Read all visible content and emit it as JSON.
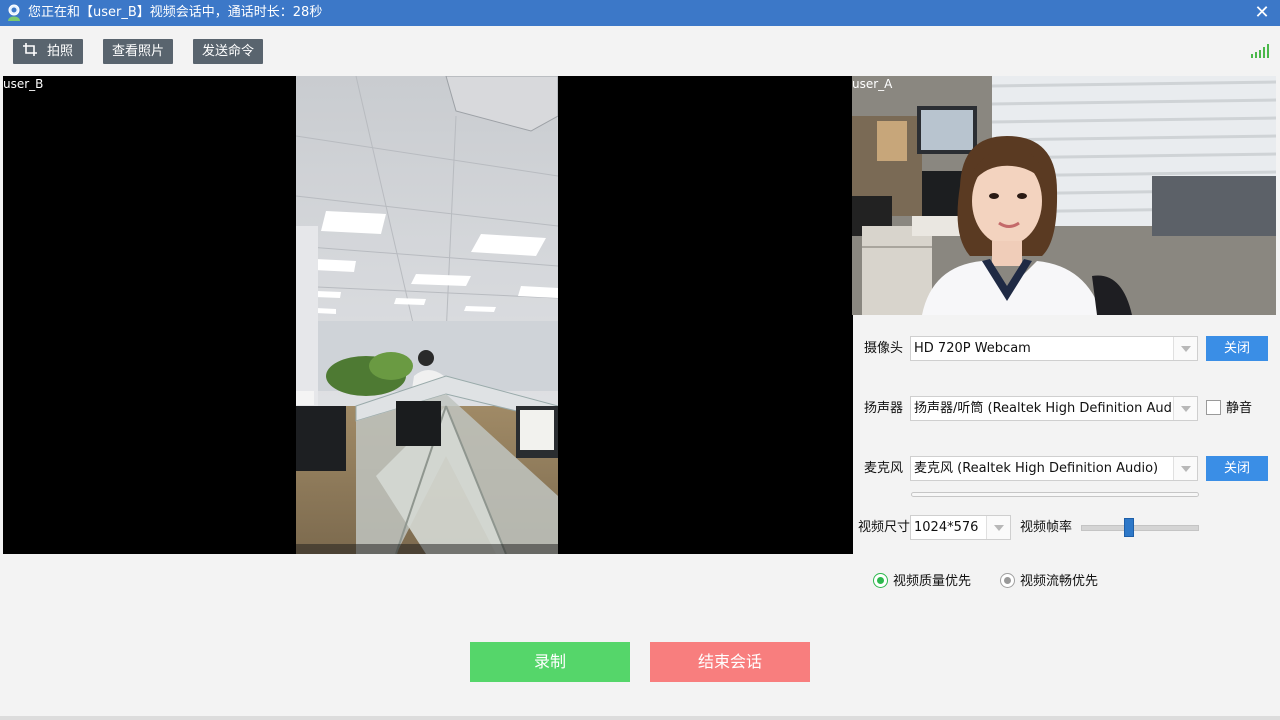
{
  "window": {
    "title": "您正在和【user_B】视频会话中，通话时长：28秒",
    "close_icon": "close-icon",
    "app_icon": "user-chat-icon"
  },
  "toolbar": {
    "photo_label": "拍照",
    "photo_icon": "crop-camera-icon",
    "view_photos_label": "查看照片",
    "send_command_label": "发送命令",
    "signal_icon": "signal-strength-icon",
    "signal_color": "#4ab84a"
  },
  "remote_video": {
    "user_label": "user_B"
  },
  "local_video": {
    "user_label": "user_A"
  },
  "settings": {
    "camera": {
      "label": "摄像头",
      "value": "HD 720P Webcam",
      "button": "关闭"
    },
    "speaker": {
      "label": "扬声器",
      "value": "扬声器/听筒 (Realtek High Definition Audio)",
      "mute_label": "静音",
      "muted": false
    },
    "microphone": {
      "label": "麦克风",
      "value": "麦克风 (Realtek High Definition Audio)",
      "button": "关闭",
      "level": 0
    },
    "video_size": {
      "label": "视频尺寸",
      "value": "1024*576"
    },
    "frame_rate": {
      "label": "视频帧率",
      "value_fraction": 0.4
    },
    "quality_options": [
      {
        "label": "视频质量优先",
        "selected": true
      },
      {
        "label": "视频流畅优先",
        "selected": false
      }
    ]
  },
  "actions": {
    "record_label": "录制",
    "end_label": "结束会话"
  },
  "colors": {
    "titlebar": "#3c78c8",
    "toolbar_button": "#59646e",
    "blue_button": "#3a8ee6",
    "record": "#55d66a",
    "end": "#f87e7e",
    "radio_selected": "#2db84d"
  }
}
